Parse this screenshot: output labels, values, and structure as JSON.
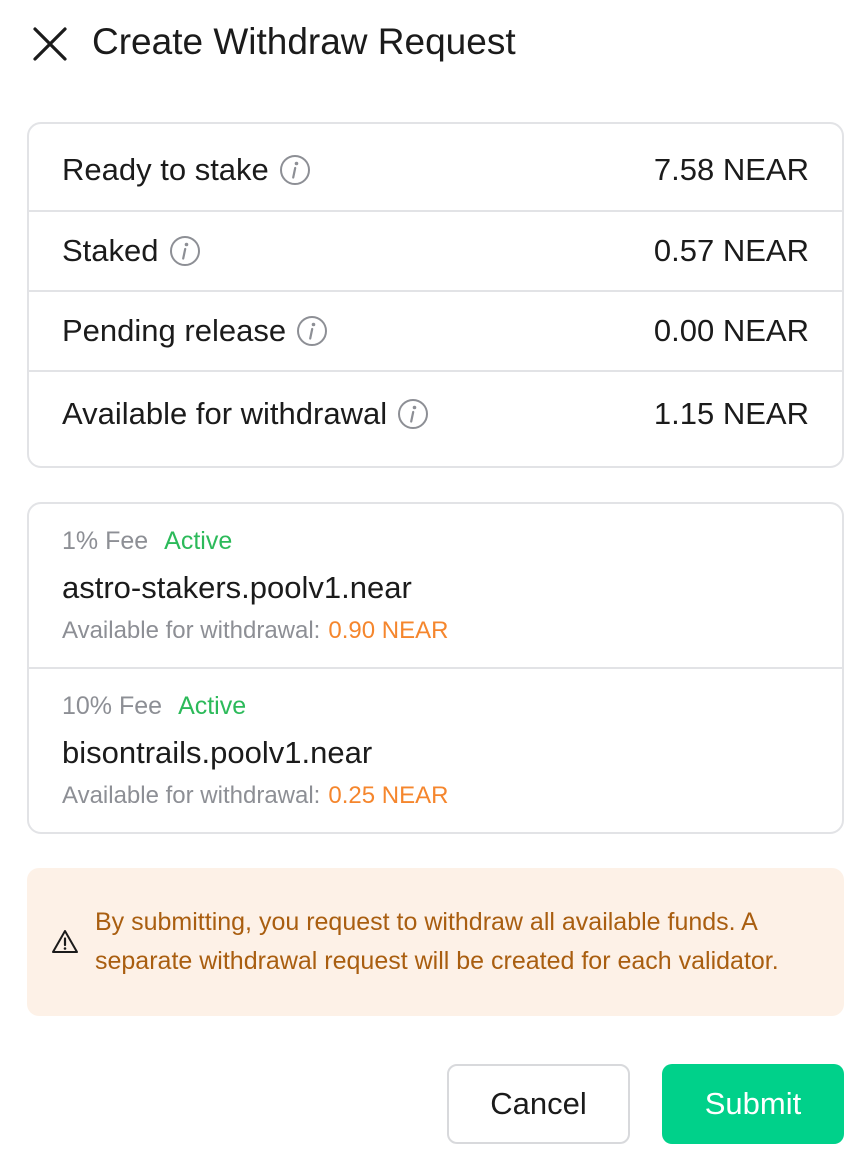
{
  "header": {
    "title": "Create Withdraw Request",
    "close_icon": "close-icon"
  },
  "summary": [
    {
      "label": "Ready to stake",
      "value": "7.58 NEAR",
      "icon": "info-icon"
    },
    {
      "label": "Staked",
      "value": "0.57 NEAR",
      "icon": "info-icon"
    },
    {
      "label": "Pending release",
      "value": "0.00 NEAR",
      "icon": "info-icon"
    },
    {
      "label": "Available for withdrawal",
      "value": "1.15 NEAR",
      "icon": "info-icon"
    }
  ],
  "validators": [
    {
      "fee": "1% Fee",
      "status": "Active",
      "name": "astro-stakers.poolv1.near",
      "available_label": "Available for withdrawal:",
      "available_amount": "0.90 NEAR"
    },
    {
      "fee": "10% Fee",
      "status": "Active",
      "name": "bisontrails.poolv1.near",
      "available_label": "Available for withdrawal:",
      "available_amount": "0.25 NEAR"
    }
  ],
  "warning": {
    "icon": "warning-icon",
    "text": "By submitting, you request to withdraw all available funds. A separate withdrawal request will be created for each validator."
  },
  "actions": {
    "cancel_label": "Cancel",
    "submit_label": "Submit"
  },
  "colors": {
    "status_active": "#2cba5a",
    "amount_accent": "#f5862d",
    "submit_bg": "#00d18a",
    "warning_bg": "#fdf1e7",
    "warning_text": "#a95e10"
  }
}
